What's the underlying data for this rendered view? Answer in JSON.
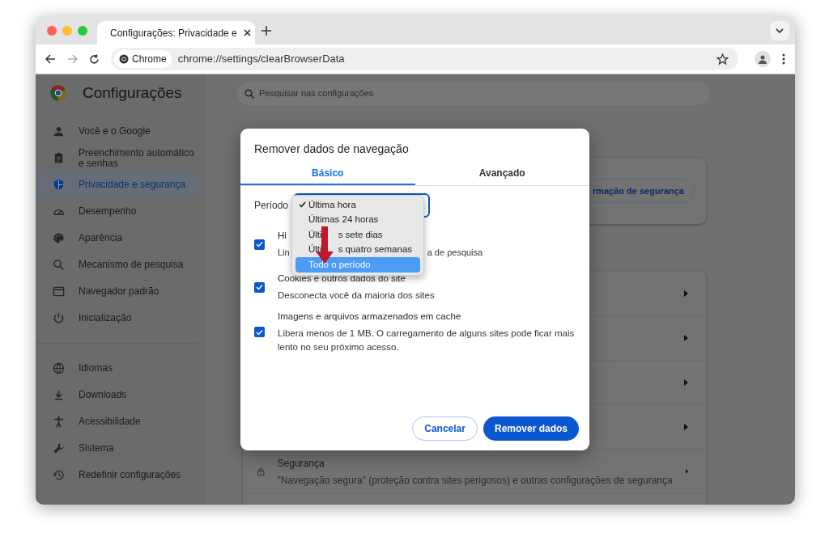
{
  "browser": {
    "tabs": [
      {
        "title": "Configurações: Privacidade e",
        "selected": true
      }
    ],
    "address": {
      "chip": "Chrome",
      "url": "chrome://settings/clearBrowserData"
    }
  },
  "settings": {
    "title": "Configurações",
    "search": {
      "placeholder": "Pesquisar nas configurações"
    },
    "sidebar": [
      [
        {
          "label": "Você e o Google",
          "selected": false
        },
        {
          "label": "Preenchimento automático e senhas",
          "selected": false
        },
        {
          "label": "Privacidade e segurança",
          "selected": true
        },
        {
          "label": "Desempenho",
          "selected": false
        },
        {
          "label": "Aparência",
          "selected": false
        },
        {
          "label": "Mecanismo de pesquisa",
          "selected": false
        },
        {
          "label": "Navegador padrão",
          "selected": false
        },
        {
          "label": "Inicialização",
          "selected": false
        }
      ],
      [
        {
          "label": "Idiomas",
          "selected": false
        },
        {
          "label": "Downloads",
          "selected": false
        },
        {
          "label": "Acessibilidade",
          "selected": false
        },
        {
          "label": "Sistema",
          "selected": false
        },
        {
          "label": "Redefinir configurações",
          "selected": false
        }
      ]
    ],
    "safety_check_button": "rmação de segurança",
    "rows": [
      {
        "kind": "covered"
      },
      {
        "kind": "covered"
      },
      {
        "kind": "covered"
      },
      {
        "kind": "covered"
      },
      {
        "kind": "text",
        "title": "Segurança",
        "description": "\"Navegação segura\" (proteção contra sites perigosos) e outras configurações de segurança"
      }
    ]
  },
  "dialog": {
    "title": "Remover dados de navegação",
    "tabs": [
      {
        "label": "Básico",
        "selected": true
      },
      {
        "label": "Avançado",
        "selected": false
      }
    ],
    "period": {
      "label": "Período",
      "options": [
        {
          "segments": [
            "Última hora"
          ],
          "selected": true,
          "highlighted": false
        },
        {
          "segments": [
            "Últimas 24 horas"
          ],
          "selected": false,
          "highlighted": false
        },
        {
          "segments": [
            "Últi",
            "s sete dias"
          ],
          "selected": false,
          "highlighted": false
        },
        {
          "segments": [
            "Últi",
            "s quatro semanas"
          ],
          "selected": false,
          "highlighted": false
        },
        {
          "segments": [
            "Todo o período"
          ],
          "selected": false,
          "highlighted": true
        }
      ]
    },
    "items": [
      {
        "checked": true,
        "title": [
          "Hi"
        ],
        "description": [
          "Lin",
          "a de pesquisa"
        ]
      },
      {
        "checked": true,
        "title": [
          "Cookies e outros dados do site"
        ],
        "description": [
          "Desconecta você da maioria dos sites"
        ]
      },
      {
        "checked": true,
        "title": [
          "Imagens e arquivos armazenados em cache"
        ],
        "description": [
          "Libera menos de 1 MB. O carregamento de alguns sites pode ficar mais lento no seu próximo acesso."
        ]
      }
    ],
    "buttons": [
      {
        "label": "Cancelar",
        "kind": "secondary"
      },
      {
        "label": "Remover dados",
        "kind": "primary"
      }
    ]
  }
}
